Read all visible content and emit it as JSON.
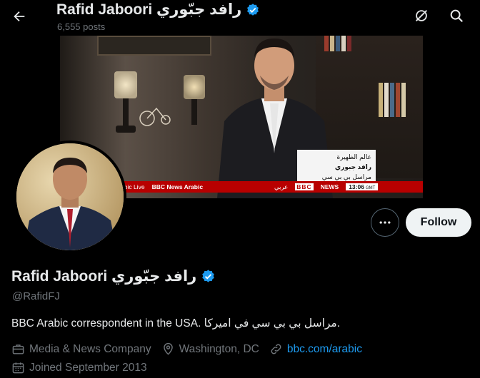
{
  "header": {
    "display_name": "Rafid Jaboori رافد جبّوري",
    "posts_count": "6,555 posts"
  },
  "banner": {
    "lower_third": [
      "عالم الظهيرة",
      "رافد جبوري",
      "مراسل بي بي سي"
    ],
    "ticker": {
      "live": "abic Live",
      "channel": "BBC News Arabic",
      "arabic": "عربي",
      "bbc": "BBC",
      "news": "NEWS",
      "time": "13:06",
      "gmt": "GMT"
    }
  },
  "actions": {
    "follow_label": "Follow"
  },
  "profile": {
    "display_name": "Rafid Jaboori رافد جبّوري",
    "handle": "@RafidFJ",
    "bio": "BBC Arabic correspondent in the USA. مراسل بي بي سي في اميركا."
  },
  "meta": {
    "category": "Media & News Company",
    "location": "Washington, DC",
    "website": "bbc.com/arabic",
    "joined": "Joined September 2013"
  },
  "colors": {
    "background": "#000000",
    "text_primary": "#e7e9ea",
    "text_secondary": "#71767b",
    "link": "#1d9bf0",
    "verified": "#1d9bf0",
    "follow_bg": "#eff3f4"
  },
  "icons": [
    "back-arrow-icon",
    "grok-icon",
    "search-icon",
    "verified-badge-icon",
    "more-icon",
    "briefcase-icon",
    "location-pin-icon",
    "link-icon",
    "calendar-icon"
  ]
}
